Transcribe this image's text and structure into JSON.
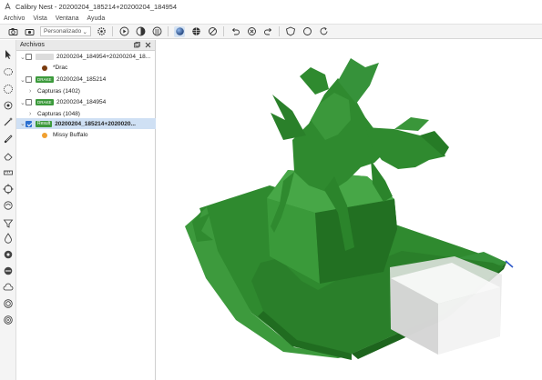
{
  "window": {
    "title": "Calibry Nest - 20200204_185214+20200204_184954"
  },
  "menu": [
    "Archivo",
    "Vista",
    "Ventana",
    "Ayuda"
  ],
  "toolbar": {
    "preset_value": "Personalizado"
  },
  "panel": {
    "title": "Archivos",
    "rows": [
      {
        "label": "20200204_184954+20200204_18...",
        "tag": "",
        "tag_color": "#dcdcdc"
      },
      {
        "label": "*Drac",
        "dot_color": "#7a3b0e"
      },
      {
        "label": "20200204_185214",
        "tag": "DRAKE",
        "tag_color": "#3c9a3c"
      },
      {
        "label": "Capturas (1402)"
      },
      {
        "label": "20200204_184954",
        "tag": "DRAKE",
        "tag_color": "#3c9a3c"
      },
      {
        "label": "Capturas (1048)"
      },
      {
        "label": "20200204_185214+2020020...",
        "tag": "Result",
        "tag_color": "#3c9a3c"
      },
      {
        "label": "Missy Buffalo",
        "dot_color": "#f0a030"
      }
    ]
  },
  "colors": {
    "model": "#2f8a2f",
    "model_dark": "#1f6a1f",
    "model_light": "#47a447",
    "selection": "#cfe0f4",
    "accent": "#2a6fd0"
  },
  "icons": [
    "camera-icon",
    "eye-icon",
    "settings-gear-icon",
    "play-icon",
    "render-mode-icon",
    "sphere-icon",
    "no-icon",
    "undo-icon",
    "delete-icon",
    "redo-icon",
    "shield-icon",
    "circle-icon",
    "refresh-icon"
  ]
}
